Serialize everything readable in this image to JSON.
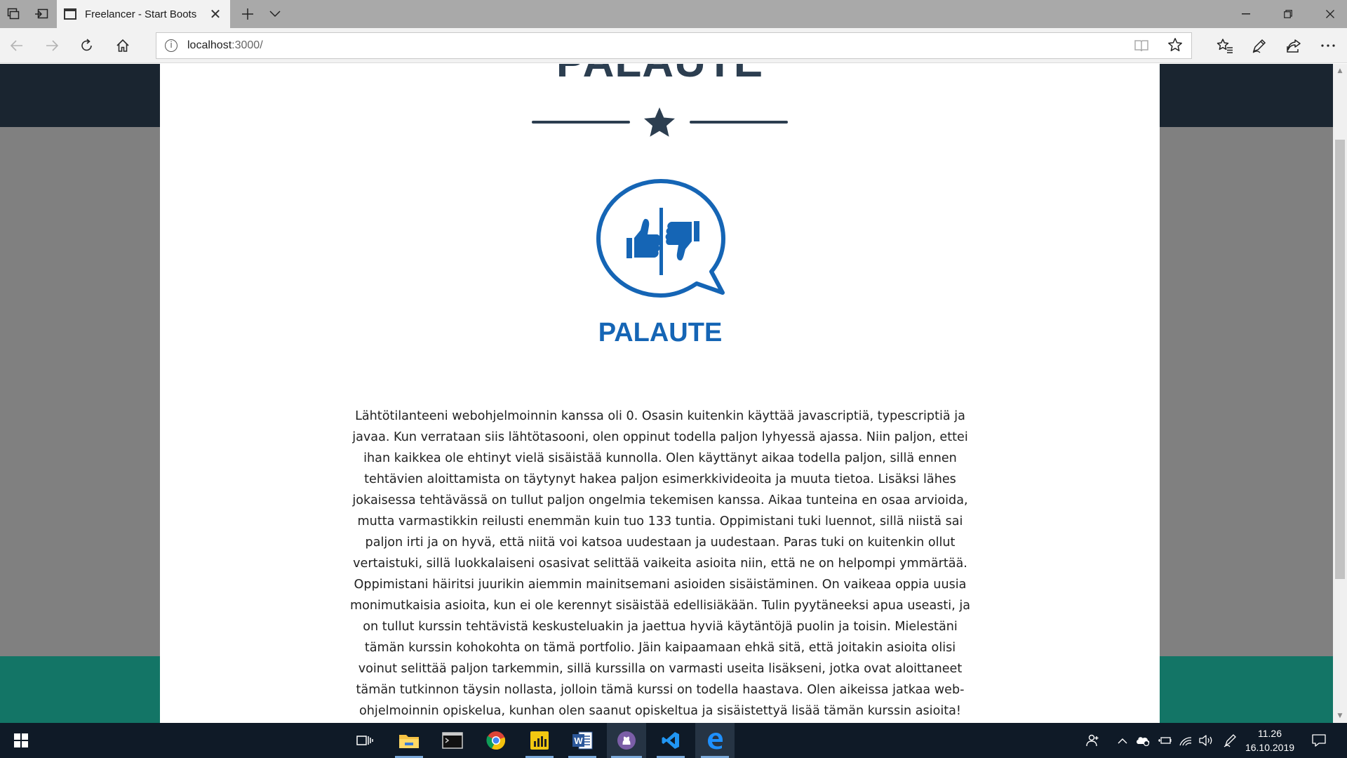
{
  "browser": {
    "tab_title": "Freelancer - Start Boots",
    "url_host": "localhost",
    "url_rest": ":3000/",
    "icons": {
      "tab_actions": "tabs-aside-icon",
      "show_tabs": "set-aside-tabs-icon",
      "new_tab": "plus-icon",
      "tab_list": "chevron-down-icon",
      "back": "arrow-left-icon",
      "forward": "arrow-right-icon",
      "refresh": "refresh-icon",
      "home": "home-icon",
      "info": "info-icon",
      "reading_view": "book-icon",
      "favorite": "star-icon",
      "favorites_hub": "favorites-icon",
      "notes": "pen-icon",
      "share": "share-icon",
      "more": "ellipsis-icon"
    }
  },
  "page": {
    "modal_title": "PALAUTE",
    "logo_label": "PALAUTE",
    "feedback_text": "Lähtötilanteeni webohjelmoinnin kanssa oli 0. Osasin kuitenkin käyttää javascriptiä, typescriptiä ja javaa. Kun verrataan siis lähtötasooni, olen oppinut todella paljon lyhyessä ajassa. Niin paljon, ettei ihan kaikkea ole ehtinyt vielä sisäistää kunnolla. Olen käyttänyt aikaa todella paljon, sillä ennen tehtävien aloittamista on täytynyt hakea paljon esimerkkivideoita ja muuta tietoa. Lisäksi lähes jokaisessa tehtävässä on tullut paljon ongelmia tekemisen kanssa. Aikaa tunteina en osaa arvioida, mutta varmastikkin reilusti enemmän kuin tuo 133 tuntia. Oppimistani tuki luennot, sillä niistä sai paljon irti ja on hyvä, että niitä voi katsoa uudestaan ja uudestaan. Paras tuki on kuitenkin ollut vertaistuki, sillä luokkalaiseni osasivat selittää vaikeita asioita niin, että ne on helpompi ymmärtää. Oppimistani häiritsi juurikin aiemmin mainitsemani asioiden sisäistäminen. On vaikeaa oppia uusia monimutkaisia asioita, kun ei ole kerennyt sisäistää edellisiäkään. Tulin pyytäneeksi apua useasti, ja on tullut kurssin tehtävistä keskusteluakin ja jaettua hyviä käytäntöjä puolin ja toisin. Mielestäni tämän kurssin kohokohta on tämä portfolio. Jäin kaipaamaan ehkä sitä, että joitakin asioita olisi voinut selittää paljon tarkemmin, sillä kurssilla on varmasti useita lisäkseni, jotka ovat aloittaneet tämän tutkinnon täysin nollasta, jolloin tämä kurssi on todella haastava. Olen aikeissa jatkaa web-ohjelmoinnin opiskelua, kunhan olen saanut opiskeltua ja sisäistettyä lisää tämän kurssin asioita! Tämä",
    "colors": {
      "title": "#2c3e50",
      "logo_blue": "#1565b5",
      "header_dark": "#1a2530",
      "teal": "#137566",
      "backdrop": "#808080"
    }
  },
  "taskbar": {
    "apps": [
      "start-icon",
      "task-view-icon",
      "file-explorer-icon",
      "terminal-icon",
      "chrome-icon",
      "power-bi-icon",
      "word-icon",
      "github-desktop-icon",
      "vscode-icon",
      "edge-icon"
    ],
    "clock_time": "11.26",
    "clock_date": "16.10.2019"
  }
}
